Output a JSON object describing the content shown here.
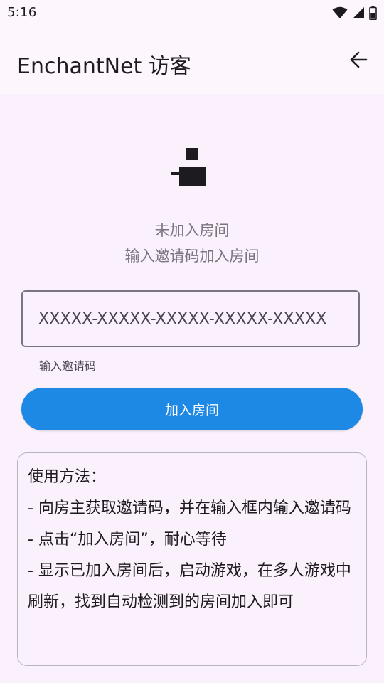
{
  "status_bar": {
    "time": "5:16",
    "icons": [
      "wifi-icon",
      "signal-icon",
      "battery-icon"
    ]
  },
  "app_bar": {
    "title": "EnchantNet 访客",
    "back_icon": "arrow-left-icon"
  },
  "room": {
    "status": "未加入房间",
    "hint": "输入邀请码加入房间"
  },
  "invite_input": {
    "placeholder": "XXXXX-XXXXX-XXXXX-XXXXX-XXXXX",
    "value": "",
    "helper": "输入邀请码"
  },
  "join_button": {
    "label": "加入房间"
  },
  "usage": {
    "title": "使用方法：",
    "steps": [
      " - 向房主获取邀请码，并在输入框内输入邀请码",
      " - 点击“加入房间”，耐心等待",
      " - 显示已加入房间后，启动游戏，在多人游戏中刷新，找到自动检测到的房间加入即可"
    ]
  },
  "colors": {
    "accent": "#1e88e5",
    "background": "#fbf1fc",
    "app_bar": "#fdf6fc",
    "muted_text": "#79757f"
  }
}
